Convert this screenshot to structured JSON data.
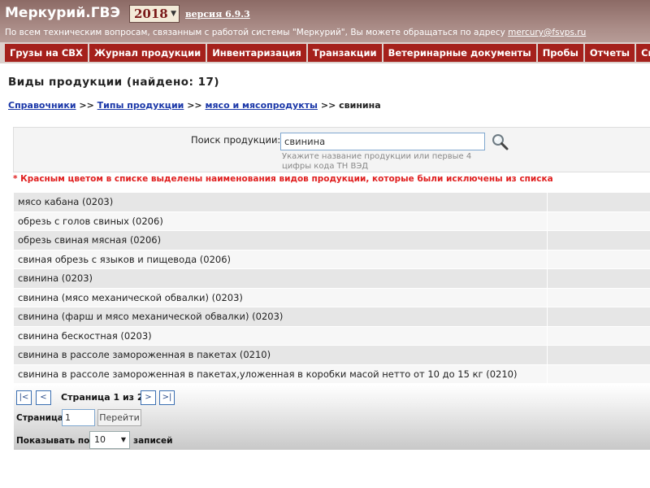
{
  "header": {
    "logo_prefix": "Меркурий.",
    "logo_suffix": "ГВЭ",
    "year": "2018",
    "version": "версия 6.9.3",
    "support_text": "По всем техническим вопросам, связанным с работой системы \"Меркурий\", Вы можете обращаться по адресу",
    "support_email": "mercury@fsvps.ru"
  },
  "menu": [
    {
      "label": "Грузы на СВХ"
    },
    {
      "label": "Журнал продукции"
    },
    {
      "label": "Инвентаризация"
    },
    {
      "label": "Транзакции"
    },
    {
      "label": "Ветеринарные документы"
    },
    {
      "label": "Пробы"
    },
    {
      "label": "Отчеты"
    },
    {
      "label": "Справо"
    }
  ],
  "page": {
    "title": "Виды продукции (найдено: 17)"
  },
  "breadcrumb": {
    "items": [
      "Справочники",
      "Типы продукции",
      "мясо и мясопродукты"
    ],
    "separator": ">>",
    "current": "свинина"
  },
  "search": {
    "label": "Поиск продукции:",
    "value": "свинина",
    "hint": "Укажите название продукции или первые 4 цифры кода ТН ВЭД"
  },
  "note": "* Красным цветом в списке выделены наименования видов продукции, которые были исключены из списка",
  "products": [
    "мясо кабана (0203)",
    "обрезь с голов свиных (0206)",
    "обрезь свиная мясная (0206)",
    "свиная обрезь с языков и пищевода (0206)",
    "свинина (0203)",
    "свинина (мясо механической обвалки) (0203)",
    "свинина (фарш и мясо механической обвалки) (0203)",
    "свинина бескостная (0203)",
    "свинина в рассоле замороженная в пакетах (0210)",
    "свинина в рассоле замороженная в пакетах,уложенная в коробки масой нетто от 10 до 15 кг (0210)"
  ],
  "pager": {
    "first": "|<",
    "prev": "<",
    "next": ">",
    "last": ">|",
    "info": "Страница 1 из 2",
    "page_label": "Страница",
    "page_value": "1",
    "go_label": "Перейти",
    "show_label": "Показывать по:",
    "per_page": "10",
    "records_label": "записей"
  },
  "colors": {
    "menu_bg": "#a5211c",
    "header_bg": "#9a7a75",
    "link": "#1a37a8",
    "note": "#e02020"
  }
}
